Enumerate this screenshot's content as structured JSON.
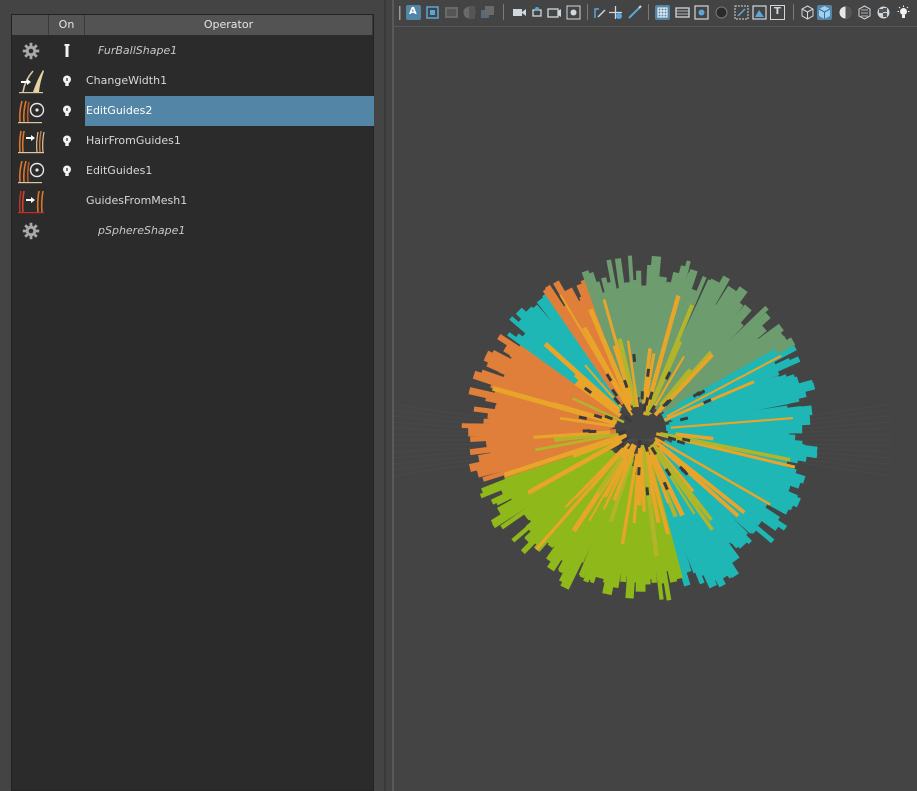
{
  "table": {
    "columns": {
      "icon": "",
      "on": "On",
      "operator": "Operator"
    },
    "rows": [
      {
        "name": "FurBallShape1",
        "kind": "shape",
        "icon": "gear-icon",
        "on": "pin-icon",
        "selected": false
      },
      {
        "name": "ChangeWidth1",
        "kind": "operator",
        "icon": "change-width-icon",
        "on": "bulb-icon",
        "selected": false
      },
      {
        "name": "EditGuides2",
        "kind": "operator",
        "icon": "edit-guides-icon",
        "on": "bulb-icon",
        "selected": true
      },
      {
        "name": "HairFromGuides1",
        "kind": "operator",
        "icon": "hair-from-guides-icon",
        "on": "bulb-icon",
        "selected": false
      },
      {
        "name": "EditGuides1",
        "kind": "operator",
        "icon": "edit-guides-icon",
        "on": "bulb-icon",
        "selected": false
      },
      {
        "name": "GuidesFromMesh1",
        "kind": "operator",
        "icon": "guides-from-mesh-icon",
        "on": "",
        "selected": false
      },
      {
        "name": "pSphereShape1",
        "kind": "shape",
        "icon": "gear-icon",
        "on": "",
        "selected": false
      }
    ]
  },
  "viewport_toolbar": {
    "icons": [
      "select-camera-icon",
      "camera-attributes-icon",
      "bookmark-icon",
      "image-plane-icon",
      "two-d-pan-icon",
      "film-gate-icon",
      "resolution-gate-icon",
      "gate-mask-icon",
      "field-chart-icon",
      "safe-action-icon",
      "safe-title-icon",
      "grid-icon",
      "film-gate-toggle-icon",
      "isolate-icon",
      "xray-icon",
      "xray-joints-icon",
      "xray-components-icon",
      "text-icon",
      "wireframe-icon",
      "smooth-shade-icon",
      "default-material-icon",
      "textured-icon",
      "lights-icon"
    ],
    "active_labels": {
      "a_button": "A",
      "t_button": "T"
    }
  },
  "fur_colors": {
    "orange": "#e07f3a",
    "sage": "#6d9c6e",
    "teal": "#1fb7b5",
    "lime": "#8fb81a",
    "gold": "#e8a52a",
    "olive": "#b2b52a"
  },
  "colors": {
    "selection": "#5285a6",
    "panel_bg": "#2b2b2b",
    "header_bg": "#535353",
    "viewport_bg": "#444444"
  }
}
